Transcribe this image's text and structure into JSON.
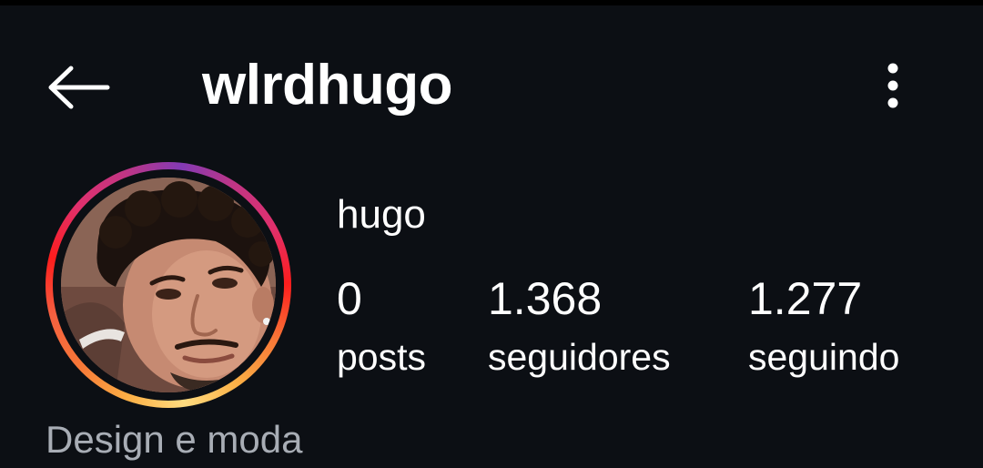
{
  "header": {
    "username": "wlrdhugo",
    "back_icon": "arrow-left-icon",
    "more_icon": "more-vertical-icon"
  },
  "profile": {
    "display_name": "hugo",
    "avatar_ring_colors": [
      "#fcaf45",
      "#f56040",
      "#e1306c",
      "#c13584",
      "#833ab4"
    ],
    "stats": {
      "posts": {
        "count": "0",
        "label": "posts"
      },
      "followers": {
        "count": "1.368",
        "label": "seguidores"
      },
      "following": {
        "count": "1.277",
        "label": "seguindo"
      }
    },
    "category": "Design e moda"
  },
  "theme": {
    "background": "#0c0f14",
    "text": "#ffffff",
    "muted_text": "#a8adb5"
  }
}
